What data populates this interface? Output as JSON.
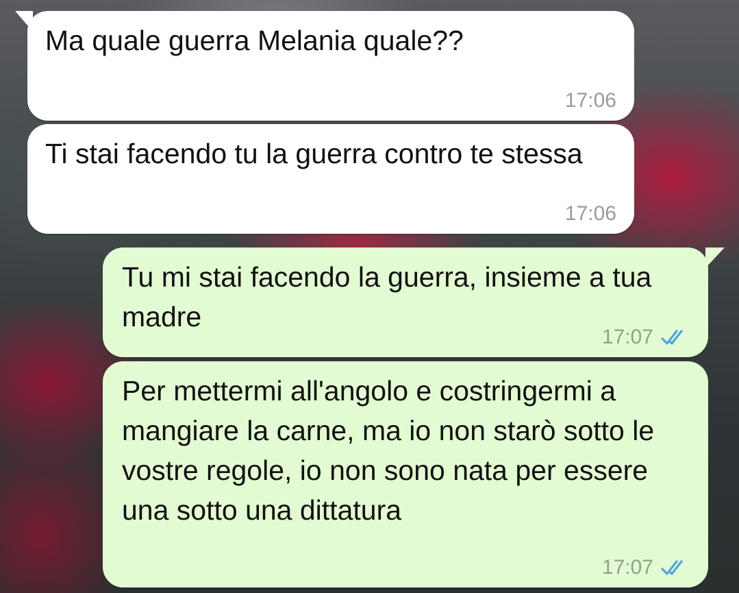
{
  "colors": {
    "incoming_bubble": "#ffffff",
    "outgoing_bubble": "#e3fbd3",
    "read_ticks": "#4fa3e0"
  },
  "messages": [
    {
      "direction": "incoming",
      "text": "Ma quale guerra Melania quale??",
      "time": "17:06"
    },
    {
      "direction": "incoming",
      "text": "Ti stai facendo tu la guerra contro te stessa",
      "time": "17:06"
    },
    {
      "direction": "outgoing",
      "text": "Tu mi stai facendo la guerra, insieme a tua madre",
      "time": "17:07",
      "status_icon": "double-check-read-icon"
    },
    {
      "direction": "outgoing",
      "text": "Per mettermi all'angolo e costringermi a mangiare la carne, ma io non starò sotto le vostre regole, io non sono nata per essere una sotto una dittatura",
      "time": "17:07",
      "status_icon": "double-check-read-icon"
    }
  ]
}
